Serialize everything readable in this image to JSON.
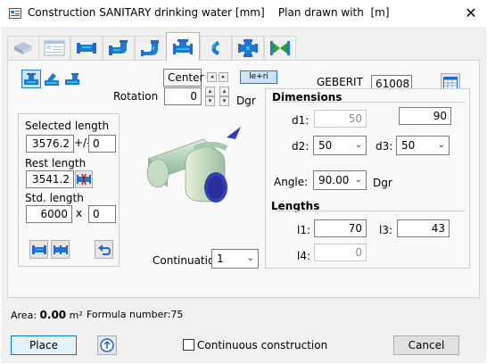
{
  "window": {
    "title": "Construction SANITARY drinking water [mm]    Plan drawn with  [m]",
    "close_icon": "close-icon"
  },
  "tabs": [
    {
      "name": "tab-pipe-3d",
      "icon": "pipe-3d-icon"
    },
    {
      "name": "tab-properties",
      "icon": "properties-icon"
    },
    {
      "name": "tab-straight-pipe",
      "icon": "straight-pipe-icon"
    },
    {
      "name": "tab-elbow",
      "icon": "elbow-icon"
    },
    {
      "name": "tab-offset",
      "icon": "offset-icon"
    },
    {
      "name": "tab-tee",
      "icon": "tee-icon",
      "active": true
    },
    {
      "name": "tab-bend",
      "icon": "bend-icon"
    },
    {
      "name": "tab-cross",
      "icon": "cross-icon"
    },
    {
      "name": "tab-valve",
      "icon": "valve-icon"
    }
  ],
  "placement": {
    "align_value": "Center",
    "rotation_label": "Rotation",
    "rotation_value": "0",
    "rotation_unit": "Dgr",
    "side_button": "le+ri"
  },
  "manufacturer": {
    "name": "GEBERIT",
    "article": "61008"
  },
  "length": {
    "selected_label": "Selected length",
    "selected_value": "3576.2",
    "tolerance_sep": "+/-",
    "tolerance_value": "0",
    "rest_label": "Rest length",
    "rest_value": "3541.2",
    "std_label": "Std. length",
    "std_value": "6000",
    "std_times": "x",
    "std_count": "0"
  },
  "continuation": {
    "label": "Continuation",
    "value": "1"
  },
  "dimensions": {
    "header": "Dimensions",
    "d1_label": "d1:",
    "d1_value": "50",
    "d1_right": "90",
    "d2_label": "d2:",
    "d2_value": "50",
    "d3_label": "d3:",
    "d3_value": "50",
    "angle_label": "Angle:",
    "angle_value": "90.00",
    "angle_unit": "Dgr"
  },
  "lengths": {
    "header": "Lengths",
    "l1_label": "l1:",
    "l1_value": "70",
    "l3_label": "l3:",
    "l3_value": "43",
    "l4_label": "l4:",
    "l4_value": "0"
  },
  "footer": {
    "area_label": "Area:",
    "area_value": "0.00",
    "area_unit": "m²",
    "formula_label": "Formula number:",
    "formula_value": "75",
    "place_button": "Place",
    "continuous_label": "Continuous construction",
    "cancel_button": "Cancel"
  },
  "colors": {
    "accent": "#1e78d6",
    "icon_blue": "#2469c8",
    "icon_cyan": "#1ec8e0",
    "valve_green": "#2ca02c",
    "fitting_green": "#b6d4b0"
  }
}
